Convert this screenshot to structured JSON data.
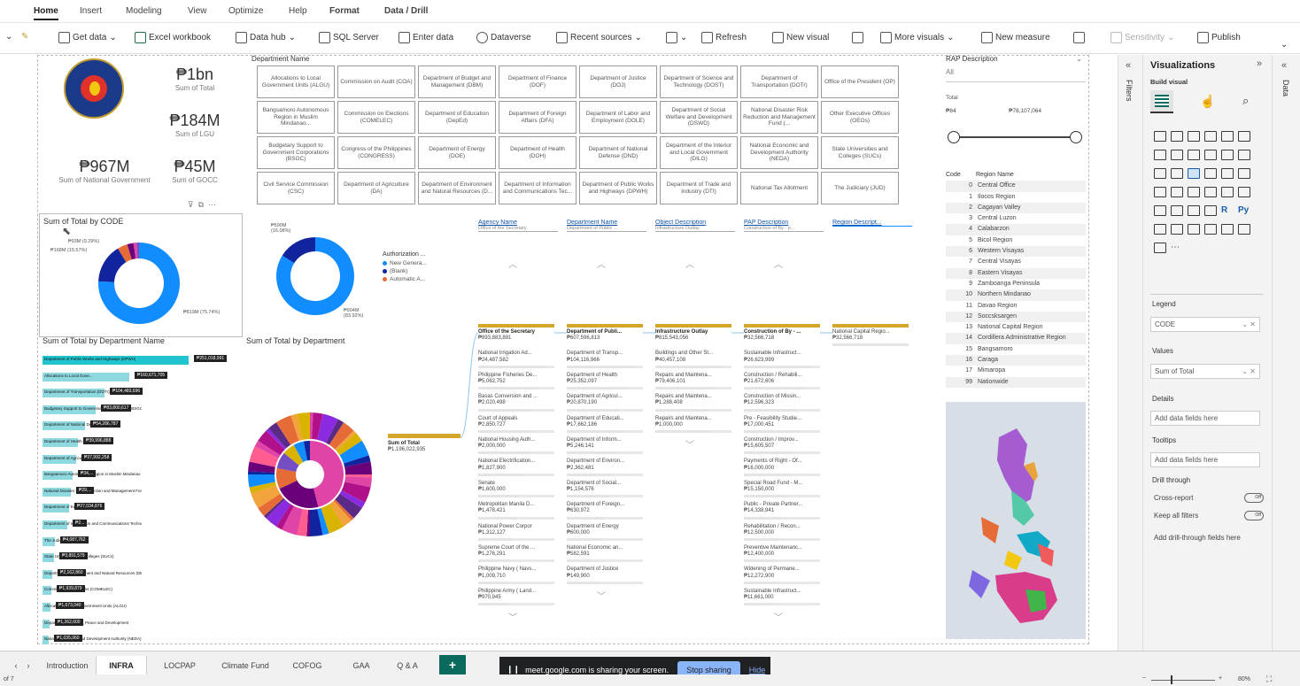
{
  "ribbon": {
    "tabs": [
      "Home",
      "Insert",
      "Modeling",
      "View",
      "Optimize",
      "Help",
      "Format",
      "Data / Drill"
    ],
    "toolbar": {
      "get_data": "Get data",
      "excel": "Excel workbook",
      "data_hub": "Data hub",
      "sql": "SQL Server",
      "enter_data": "Enter data",
      "dataverse": "Dataverse",
      "recent": "Recent sources",
      "refresh": "Refresh",
      "new_visual": "New visual",
      "more_visuals": "More visuals",
      "new_measure": "New measure",
      "sensitivity": "Sensitivity",
      "publish": "Publish"
    }
  },
  "kpis": [
    {
      "value": "₱1bn",
      "label": "Sum of Total"
    },
    {
      "value": "₱184M",
      "label": "Sum of LGU"
    },
    {
      "value": "₱967M",
      "label": "Sum of National Government"
    },
    {
      "value": "₱45M",
      "label": "Sum of GOCC"
    }
  ],
  "dept_slicer": {
    "title": "Department Name",
    "items": [
      "Allocations to Local Government Units (ALGU)",
      "Commission on Audit (COA)",
      "Department of Budget and Management (DBM)",
      "Department of Finance (DOF)",
      "Department of Justice (DOJ)",
      "Department of Science and Technology (DOST)",
      "Department of Transportation (DOTr)",
      "Office of the President (OP)",
      "Bangsamoro Autonomous Region in Muslim Mindanao...",
      "Commission on Elections (COMELEC)",
      "Department of Education (DepEd)",
      "Department of Foreign Affairs (DFA)",
      "Department of Labor and Employment (DOLE)",
      "Department of Social Welfare and Development (DSWD)",
      "National Disaster Risk Reduction and Management Fund (...",
      "Other Executive Offices (OEOs)",
      "Budgetary Support to Government Corporations (BSGC)",
      "Congress of the Philippines (CONGRESS)",
      "Department of Energy (DOE)",
      "Department of Health (DOH)",
      "Department of National Defense (DND)",
      "Department of the Interior and Local Government (DILG)",
      "National Economic and Development Authority (NEDA)",
      "State Universities and Colleges (SUCs)",
      "Civil Service Commission (CSC)",
      "Department of Agriculture (DA)",
      "Department of Environment and Natural Resources (D...",
      "Department of Information and Communications Tec...",
      "Department of Public Works and Highways (DPWH)",
      "Department of Trade and Industry (DTI)",
      "National Tax Allotment",
      "The Judiciary (JUD)"
    ]
  },
  "rap_slicer": {
    "title": "RAP Description",
    "value": "All",
    "total_label": "Total",
    "min": "₱84",
    "max": "₱78,107,064"
  },
  "code_table": {
    "headers": [
      "Code",
      "Region Name"
    ],
    "rows": [
      [
        "0",
        "Central Office"
      ],
      [
        "1",
        "Ilocos Region"
      ],
      [
        "2",
        "Cagayan Valley"
      ],
      [
        "3",
        "Central Luzon"
      ],
      [
        "4",
        "Calabarzon"
      ],
      [
        "5",
        "Bicol Region"
      ],
      [
        "6",
        "Western Visayas"
      ],
      [
        "7",
        "Central Visayas"
      ],
      [
        "8",
        "Eastern Visayas"
      ],
      [
        "9",
        "Zamboanga Peninsula"
      ],
      [
        "10",
        "Northern Mindanao"
      ],
      [
        "11",
        "Davao Region"
      ],
      [
        "12",
        "Soccsksargen"
      ],
      [
        "13",
        "National Capital Region"
      ],
      [
        "14",
        "Cordillera Administrative Region"
      ],
      [
        "15",
        "Bangsamoro"
      ],
      [
        "16",
        "Caraga"
      ],
      [
        "17",
        "Mimaropa"
      ],
      [
        "99",
        "Nationwide"
      ]
    ]
  },
  "donut_code": {
    "title": "Sum of Total by CODE",
    "labels": [
      "₱93M (9.29%)",
      "₱168M (15.57%)",
      "₱819M (75.74%)"
    ]
  },
  "donut_auth": {
    "legend_title": "Authorization ...",
    "legend": [
      "New Genera...",
      "(Blank)",
      "Automatic A..."
    ],
    "labels": [
      "₱590M (16.08%)",
      "₱904M (83.92%)"
    ]
  },
  "bar_dept": {
    "title": "Sum of Total by Department Name",
    "labels": [
      "Department of Public Works and Highways (DPWH)",
      "Allocations to Local Gove...",
      "Department of Transportation (DOTr)",
      "Budgetary Support to Government Corporations (BSGC)",
      "Department of National Defense (DND)",
      "Department of Health (DOH)",
      "Department of Agriculture (DA)",
      "Bangsamoro Autonomous Region in Muslim Mindanao (BARMM)",
      "National Disaster Risk Reduction and Management Fund",
      "Department of Education (DepEd)",
      "Department of Information and Communications Technology (DICT)",
      "The Judiciary (JUD)",
      "State Universities and Colleges (SUCs)",
      "Department of Environment and Natural Resources (DENR)",
      "Commission on Elections (COMELEC)",
      "Allocations to Local Government Units (ALGU)",
      "Department of Interior, Peace and Development",
      "National Economic and Development Authority (NEDA)"
    ],
    "value_labels": [
      "₱251,018,991",
      "₱160,671,705",
      "₱104,483,696",
      "₱83,800,617",
      "₱54,286,787",
      "₱39,996,888",
      "₱37,992,258",
      "₱34,...",
      "₱29,...",
      "₱27,034,876",
      "₱2...",
      "₱4,087,762",
      "₱3,891,579",
      "₱2,162,860",
      "₱1,939,879",
      "₱1,673,040",
      "₱1,262,600",
      "₱1,035,060"
    ]
  },
  "sunburst": {
    "title": "Sum of Total by Department"
  },
  "decomp": {
    "root": {
      "name": "Sum of Total",
      "value": "₱1,196,022,935"
    },
    "levels": [
      {
        "header": "Agency Name",
        "sub": "Office of the Secretary"
      },
      {
        "header": "Department Name",
        "sub": "Department of Public ..."
      },
      {
        "header": "Object Description",
        "sub": "Infrastructure Outlay"
      },
      {
        "header": "PAP Description",
        "sub": "Construction of By - p..."
      },
      {
        "header": "Region Descript...",
        "sub": ""
      }
    ],
    "columns": [
      [
        [
          "Office of the Secretary",
          "₱893,883,881"
        ],
        [
          "National Irrigation Ad...",
          "₱24,487,582"
        ],
        [
          "Philippine Fisheries De...",
          "₱5,062,752"
        ],
        [
          "Basas Conversion and ...",
          "₱2,020,498"
        ],
        [
          "Court of Appeals",
          "₱2,850,727"
        ],
        [
          "National Housing Auth...",
          "₱2,000,000"
        ],
        [
          "National Electrification...",
          "₱1,827,900"
        ],
        [
          "Senate",
          "₱1,600,000"
        ],
        [
          "Metropolitan Manila D...",
          "₱1,478,421"
        ],
        [
          "National Power Corpor",
          "₱1,312,127"
        ],
        [
          "Supreme Court of the ...",
          "₱1,276,291"
        ],
        [
          "Philippine Navy ( Navs...",
          "₱1,009,710"
        ],
        [
          "Philippine Army ( Land...",
          "₱970,945"
        ]
      ],
      [
        [
          "Department of Publi...",
          "₱607,596,813"
        ],
        [
          "Department of Transp...",
          "₱104,116,966"
        ],
        [
          "Department of Health",
          "₱25,352,097"
        ],
        [
          "Department of Agricul...",
          "₱20,870,190"
        ],
        [
          "Department of Educati...",
          "₱17,662,186"
        ],
        [
          "Department of Inform...",
          "₱5,246,141"
        ],
        [
          "Department of Environ...",
          "₱2,362,481"
        ],
        [
          "Department of Social...",
          "₱1,154,576"
        ],
        [
          "Department of Foreign...",
          "₱630,972"
        ],
        [
          "Department of Energy",
          "₱600,000"
        ],
        [
          "National Economic an...",
          "₱582,591"
        ],
        [
          "Department of Justice",
          "₱149,900"
        ]
      ],
      [
        [
          "Infrastructure Outlay",
          "₱815,543,056"
        ],
        [
          "Buildings and Other St...",
          "₱40,457,108"
        ],
        [
          "Repairs and Maintena...",
          "₱79,406,101"
        ],
        [
          "Repairs and Maintena...",
          "₱1,288,408"
        ],
        [
          "Repairs and Maintena...",
          "₱1,000,000"
        ]
      ],
      [
        [
          "Construction of By - ...",
          "₱32,566,718"
        ],
        [
          "Sustainable Infrastruct...",
          "₱26,623,999"
        ],
        [
          "Construction / Rehabili...",
          "₱21,672,606"
        ],
        [
          "Construction of Missin...",
          "₱12,596,323"
        ],
        [
          "Pre - Feasibility Studie...",
          "₱17,000,451"
        ],
        [
          "Construction / Improv...",
          "₱15,605,507"
        ],
        [
          "Payments of Right - Of...",
          "₱16,000,000"
        ],
        [
          "Special Road Fund - M...",
          "₱15,150,000"
        ],
        [
          "Public - Private Partner...",
          "₱14,338,941"
        ],
        [
          "Rehabilitation / Recon...",
          "₱12,500,000"
        ],
        [
          "Preventive Maintenanc...",
          "₱12,400,000"
        ],
        [
          "Widening of Permane...",
          "₱12,272,900"
        ],
        [
          "Sustainable Infrastruct...",
          "₱11,661,000"
        ]
      ],
      [
        [
          "National Capital Regio...",
          "₱32,566,718"
        ]
      ]
    ]
  },
  "viz_pane": {
    "title": "Visualizations",
    "build": "Build visual",
    "legend_label": "Legend",
    "legend_field": "CODE",
    "values_label": "Values",
    "values_field": "Sum of Total",
    "details_label": "Details",
    "details_add": "Add data fields here",
    "tooltips_label": "Tooltips",
    "tooltips_add": "Add data fields here",
    "drill_label": "Drill through",
    "cross_report": "Cross-report",
    "keep_filters": "Keep all filters",
    "toggle": "Off",
    "drill_add": "Add drill-through fields here"
  },
  "side_labels": {
    "filters": "Filters",
    "data": "Data"
  },
  "pages": [
    "Introduction",
    "INFRA",
    "LOCPAP",
    "Climate Fund",
    "COFOG",
    "GAA",
    "Q & A"
  ],
  "share": {
    "text": "meet.google.com is sharing your screen.",
    "stop": "Stop sharing",
    "hide": "Hide"
  },
  "status": {
    "page": "of 7",
    "zoom": "80%"
  },
  "colors": {
    "accent": "#f2c811",
    "teal": "#00b7c3",
    "blue": "#118dff",
    "dark": "#12239e",
    "orange": "#e66c37",
    "gold": "#d5a62b"
  }
}
